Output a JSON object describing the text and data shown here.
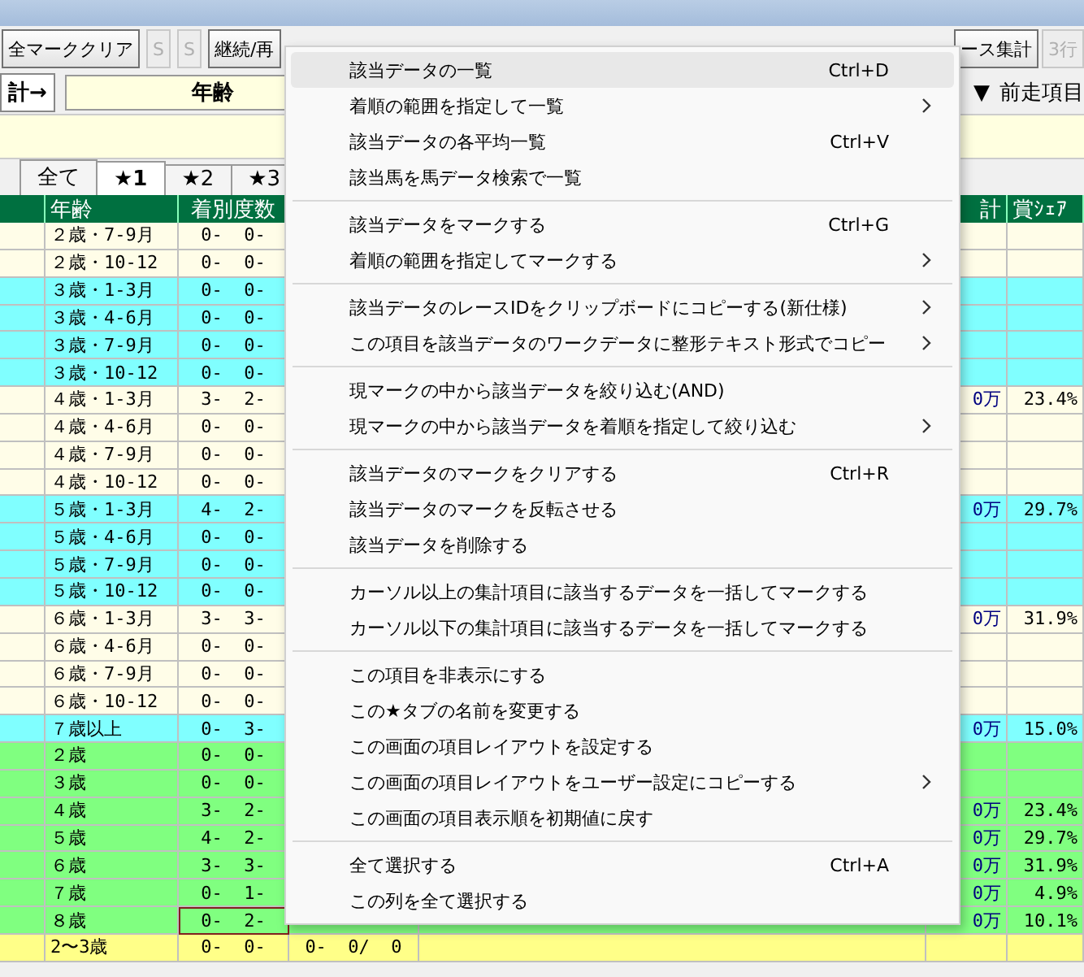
{
  "toolbar": {
    "left": [
      {
        "label": "全マーククリア",
        "disabled": false
      },
      {
        "label": "S",
        "disabled": true
      },
      {
        "label": "S",
        "disabled": true
      },
      {
        "label": "継続/再",
        "disabled": false
      }
    ],
    "right": [
      {
        "label": "ース集計",
        "disabled": false
      },
      {
        "label": "3行",
        "disabled": true
      }
    ]
  },
  "filter_bar": {
    "label": "計→",
    "field": "年齢",
    "right_arrow": "▼",
    "right_label": "前走項目"
  },
  "tabs": [
    {
      "label": "全て",
      "selected": false
    },
    {
      "label": "★1",
      "selected": true
    },
    {
      "label": "★2",
      "selected": false
    },
    {
      "label": "★3",
      "selected": false
    }
  ],
  "table": {
    "columns": [
      "年齢",
      "着別度数",
      "計",
      "賞ｼｪｱ"
    ],
    "rows": [
      {
        "age": "２歳・7-9月",
        "record": "0-  0-",
        "color": "#fffde8",
        "selected": false
      },
      {
        "age": "２歳・10-12",
        "record": "0-  0-",
        "color": "#fffde8",
        "selected": false
      },
      {
        "age": "３歳・1-3月",
        "record": "0-  0-",
        "color": "#80ffff",
        "selected": false
      },
      {
        "age": "３歳・4-6月",
        "record": "0-  0-",
        "color": "#80ffff",
        "selected": false
      },
      {
        "age": "３歳・7-9月",
        "record": "0-  0-",
        "color": "#80ffff",
        "selected": false
      },
      {
        "age": "３歳・10-12",
        "record": "0-  0-",
        "color": "#80ffff",
        "selected": false
      },
      {
        "age": "４歳・1-3月",
        "record": "3-  2-",
        "total": "0万",
        "share": "23.4%",
        "color": "#fffde8",
        "selected": false
      },
      {
        "age": "４歳・4-6月",
        "record": "0-  0-",
        "color": "#fffde8",
        "selected": false
      },
      {
        "age": "４歳・7-9月",
        "record": "0-  0-",
        "color": "#fffde8",
        "selected": false
      },
      {
        "age": "４歳・10-12",
        "record": "0-  0-",
        "color": "#fffde8",
        "selected": false
      },
      {
        "age": "５歳・1-3月",
        "record": "4-  2-",
        "total": "0万",
        "share": "29.7%",
        "color": "#80ffff",
        "selected": false
      },
      {
        "age": "５歳・4-6月",
        "record": "0-  0-",
        "color": "#80ffff",
        "selected": false
      },
      {
        "age": "５歳・7-9月",
        "record": "0-  0-",
        "color": "#80ffff",
        "selected": false
      },
      {
        "age": "５歳・10-12",
        "record": "0-  0-",
        "color": "#80ffff",
        "selected": false
      },
      {
        "age": "６歳・1-3月",
        "record": "3-  3-",
        "total": "0万",
        "share": "31.9%",
        "color": "#fffde8",
        "selected": false
      },
      {
        "age": "６歳・4-6月",
        "record": "0-  0-",
        "color": "#fffde8",
        "selected": false
      },
      {
        "age": "６歳・7-9月",
        "record": "0-  0-",
        "color": "#fffde8",
        "selected": false
      },
      {
        "age": "６歳・10-12",
        "record": "0-  0-",
        "color": "#fffde8",
        "selected": false
      },
      {
        "age": "７歳以上",
        "record": "0-  3-",
        "total": "0万",
        "share": "15.0%",
        "color": "#80ffff",
        "selected": false
      },
      {
        "age": "２歳",
        "record": "0-  0-",
        "color": "#80ff80",
        "selected": false
      },
      {
        "age": "３歳",
        "record": "0-  0-",
        "color": "#80ff80",
        "selected": false
      },
      {
        "age": "４歳",
        "record": "3-  2-",
        "total": "0万",
        "share": "23.4%",
        "color": "#80ff80",
        "selected": false
      },
      {
        "age": "５歳",
        "record": "4-  2-",
        "total": "0万",
        "share": "29.7%",
        "color": "#80ff80",
        "selected": false
      },
      {
        "age": "６歳",
        "record": "3-  3-",
        "total": "0万",
        "share": "31.9%",
        "color": "#80ff80",
        "selected": false
      },
      {
        "age": "７歳",
        "record": "0-  1-",
        "total": "0万",
        "share": "4.9%",
        "color": "#80ff80",
        "selected": false
      },
      {
        "age": "８歳",
        "record": "0-  2-",
        "total": "0万",
        "share": "10.1%",
        "color": "#80ff80",
        "selected": true
      },
      {
        "age": "2〜3歳",
        "record": "0-  0-",
        "extra": "0-  0/  0",
        "color": "#ffff88",
        "selected": false
      }
    ]
  },
  "context_menu": {
    "groups": [
      [
        {
          "label": "該当データの一覧",
          "shortcut": "Ctrl+D",
          "submenu": false,
          "highlighted": true
        },
        {
          "label": "着順の範囲を指定して一覧",
          "submenu": true,
          "highlighted": false
        },
        {
          "label": "該当データの各平均一覧",
          "shortcut": "Ctrl+V",
          "submenu": false,
          "highlighted": false
        },
        {
          "label": "該当馬を馬データ検索で一覧",
          "submenu": false,
          "highlighted": false
        }
      ],
      [
        {
          "label": "該当データをマークする",
          "shortcut": "Ctrl+G",
          "submenu": false,
          "highlighted": false
        },
        {
          "label": "着順の範囲を指定してマークする",
          "submenu": true,
          "highlighted": false
        }
      ],
      [
        {
          "label": "該当データのレースIDをクリップボードにコピーする(新仕様)",
          "submenu": true,
          "highlighted": false
        },
        {
          "label": "この項目を該当データのワークデータに整形テキスト形式でコピー",
          "submenu": true,
          "highlighted": false
        }
      ],
      [
        {
          "label": "現マークの中から該当データを絞り込む(AND)",
          "submenu": false,
          "highlighted": false
        },
        {
          "label": "現マークの中から該当データを着順を指定して絞り込む",
          "submenu": true,
          "highlighted": false
        }
      ],
      [
        {
          "label": "該当データのマークをクリアする",
          "shortcut": "Ctrl+R",
          "submenu": false,
          "highlighted": false
        },
        {
          "label": "該当データのマークを反転させる",
          "submenu": false,
          "highlighted": false
        },
        {
          "label": "該当データを削除する",
          "submenu": false,
          "highlighted": false
        }
      ],
      [
        {
          "label": "カーソル以上の集計項目に該当するデータを一括してマークする",
          "submenu": false,
          "highlighted": false
        },
        {
          "label": "カーソル以下の集計項目に該当するデータを一括してマークする",
          "submenu": false,
          "highlighted": false
        }
      ],
      [
        {
          "label": "この項目を非表示にする",
          "submenu": false,
          "highlighted": false
        },
        {
          "label": "この★タブの名前を変更する",
          "submenu": false,
          "highlighted": false
        },
        {
          "label": "この画面の項目レイアウトを設定する",
          "submenu": false,
          "highlighted": false
        },
        {
          "label": "この画面の項目レイアウトをユーザー設定にコピーする",
          "submenu": true,
          "highlighted": false
        },
        {
          "label": "この画面の項目表示順を初期値に戻す",
          "submenu": false,
          "highlighted": false
        }
      ],
      [
        {
          "label": "全て選択する",
          "shortcut": "Ctrl+A",
          "submenu": false,
          "highlighted": false
        },
        {
          "label": "この列を全て選択する",
          "submenu": false,
          "highlighted": false
        }
      ]
    ]
  }
}
